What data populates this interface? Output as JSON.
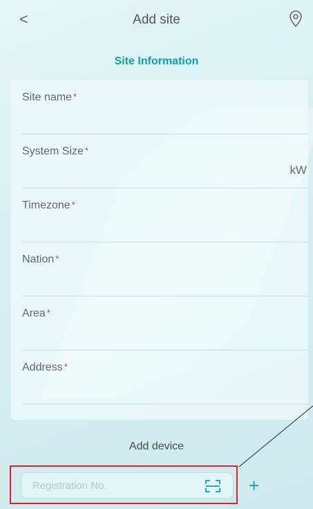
{
  "header": {
    "title": "Add site",
    "back_icon": "<",
    "location_icon": "location-pin-icon"
  },
  "site_information": {
    "title": "Site Information",
    "fields": [
      {
        "label": "Site name",
        "required": "*"
      },
      {
        "label": "System Size",
        "required": "*",
        "unit": "kW"
      },
      {
        "label": "Timezone",
        "required": "*"
      },
      {
        "label": "Nation",
        "required": "*"
      },
      {
        "label": "Area",
        "required": "*"
      },
      {
        "label": "Address",
        "required": "*"
      }
    ]
  },
  "add_device": {
    "title": "Add device",
    "registration_placeholder": "Registration No.",
    "plus_label": "+"
  },
  "colors": {
    "accent": "#0fa3a8",
    "required": "#e0383a",
    "highlight_box": "#e01f2a"
  }
}
